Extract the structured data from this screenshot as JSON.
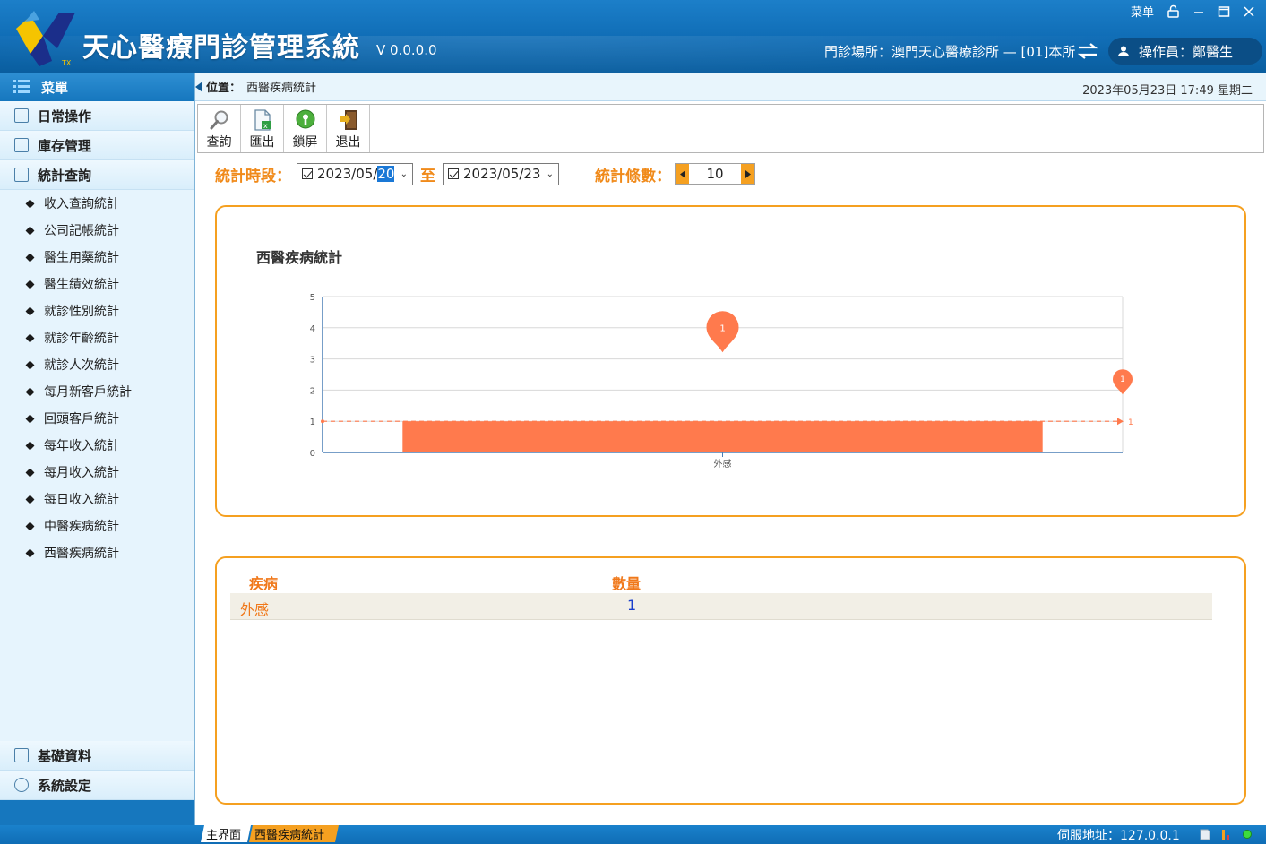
{
  "window": {
    "title": "天心醫療門診管理系統",
    "version": "V 0.0.0.0",
    "menu_label": "菜单",
    "clinic_label": "門診場所：",
    "clinic_value": "澳門天心醫療診所 — [01]本所",
    "operator_label": "操作員：",
    "operator_value": "鄭醫生"
  },
  "sidebar": {
    "header": "菜單",
    "groups_top": [
      {
        "label": "日常操作",
        "icon": "calendar-icon"
      },
      {
        "label": "庫存管理",
        "icon": "inventory-icon"
      },
      {
        "label": "統計查詢",
        "icon": "stats-icon"
      }
    ],
    "items": [
      "收入查詢統計",
      "公司記帳統計",
      "醫生用藥統計",
      "醫生績效統計",
      "就診性別統計",
      "就診年齡統計",
      "就診人次統計",
      "每月新客戶統計",
      "回頭客戶統計",
      "每年收入統計",
      "每月收入統計",
      "每日收入統計",
      "中醫疾病統計",
      "西醫疾病統計"
    ],
    "groups_bottom": [
      {
        "label": "基礎資料",
        "icon": "list-icon"
      },
      {
        "label": "系統設定",
        "icon": "settings-icon"
      }
    ]
  },
  "location": {
    "label": "位置：",
    "value": "西醫疾病統計",
    "datetime": "2023年05月23日 17:49  星期二"
  },
  "toolbar": {
    "query": "查詢",
    "export": "匯出",
    "lock": "鎖屏",
    "exit": "退出"
  },
  "filter": {
    "period_label": "統計時段：",
    "start_prefix": "2023/05/",
    "start_selected": "20",
    "to_label": "至",
    "end_date": "2023/05/23",
    "count_label": "統計條數：",
    "count_value": "10"
  },
  "chart_data": {
    "type": "bar",
    "title": "西醫疾病統計",
    "categories": [
      "外感"
    ],
    "values": [
      1
    ],
    "ylim": [
      0,
      5
    ],
    "yticks": [
      0,
      1,
      2,
      3,
      4,
      5
    ],
    "max_marker": "1",
    "markline_value": "1",
    "bar_color": "#ff7a4d",
    "grid": true
  },
  "table": {
    "headers": [
      "疾病",
      "數量"
    ],
    "rows": [
      {
        "disease": "外感",
        "count": "1"
      }
    ]
  },
  "status": {
    "tab_main": "主界面",
    "tab_current": "西醫疾病統計",
    "server_label": "伺服地址：",
    "server_value": "127.0.0.1"
  }
}
